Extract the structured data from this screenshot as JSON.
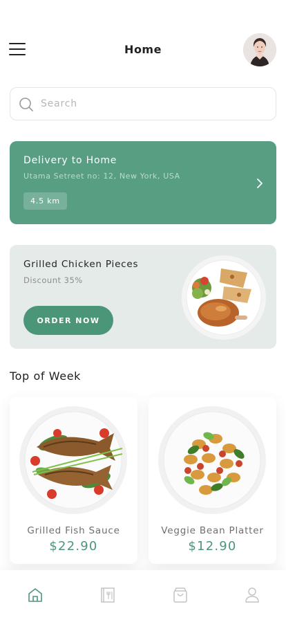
{
  "header": {
    "title": "Home",
    "menu_icon": "hamburger-menu-icon",
    "avatar": "user-avatar"
  },
  "search": {
    "placeholder": "Search",
    "value": "",
    "icon": "search-icon"
  },
  "delivery": {
    "title": "Delivery to Home",
    "address": "Utama Setreet no: 12, New York, USA",
    "distance": "4.5 km",
    "icon": "chevron-right-icon",
    "color": "#579e83"
  },
  "promo": {
    "title": "Grilled Chicken Pieces",
    "subtitle": "Discount 35%",
    "button_label": "ORDER NOW",
    "background": "#e5ebe8",
    "button_color": "#4b9679"
  },
  "top_of_week": {
    "title": "Top of Week",
    "items": [
      {
        "name": "Grilled Fish Sauce",
        "price": "$22.90"
      },
      {
        "name": "Veggie Bean Platter",
        "price": "$12.90"
      }
    ]
  },
  "bottom_nav": {
    "items": [
      {
        "icon": "home-icon",
        "active": true
      },
      {
        "icon": "menu-book-icon",
        "active": false
      },
      {
        "icon": "shopping-bag-icon",
        "active": false
      },
      {
        "icon": "profile-icon",
        "active": false
      }
    ],
    "active_color": "#4b9679",
    "inactive_color": "#c4c4c4"
  }
}
